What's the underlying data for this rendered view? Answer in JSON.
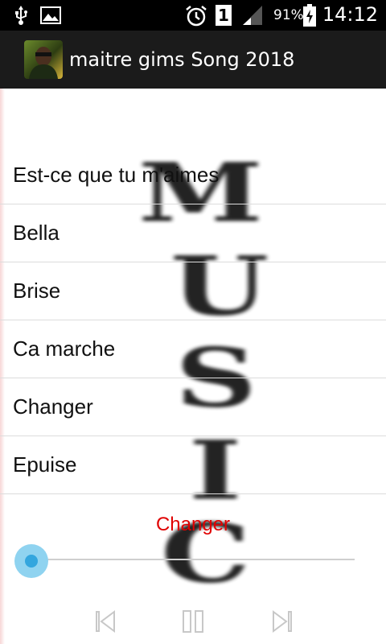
{
  "status_bar": {
    "icons": [
      "usb-icon",
      "image-icon",
      "alarm-icon",
      "sim-1-icon",
      "signal-icon",
      "battery-charging-icon"
    ],
    "sim_label": "1",
    "battery": "91%",
    "time": "14:12"
  },
  "app_bar": {
    "icon": "app-avatar-icon",
    "title": "maitre gims Song 2018"
  },
  "background": {
    "letters": [
      "M",
      "U",
      "S",
      "I",
      "C"
    ]
  },
  "songs": [
    {
      "title": "Est-ce que tu m'aimes"
    },
    {
      "title": "Bella"
    },
    {
      "title": "Brise"
    },
    {
      "title": "Ca marche"
    },
    {
      "title": "Changer"
    },
    {
      "title": "Epuise"
    }
  ],
  "player": {
    "now_playing": "Changer",
    "progress": 0.0,
    "controls": [
      "previous-icon",
      "pause-icon",
      "next-icon"
    ],
    "accent_color": "#33a6de",
    "now_playing_color": "#e00000"
  }
}
